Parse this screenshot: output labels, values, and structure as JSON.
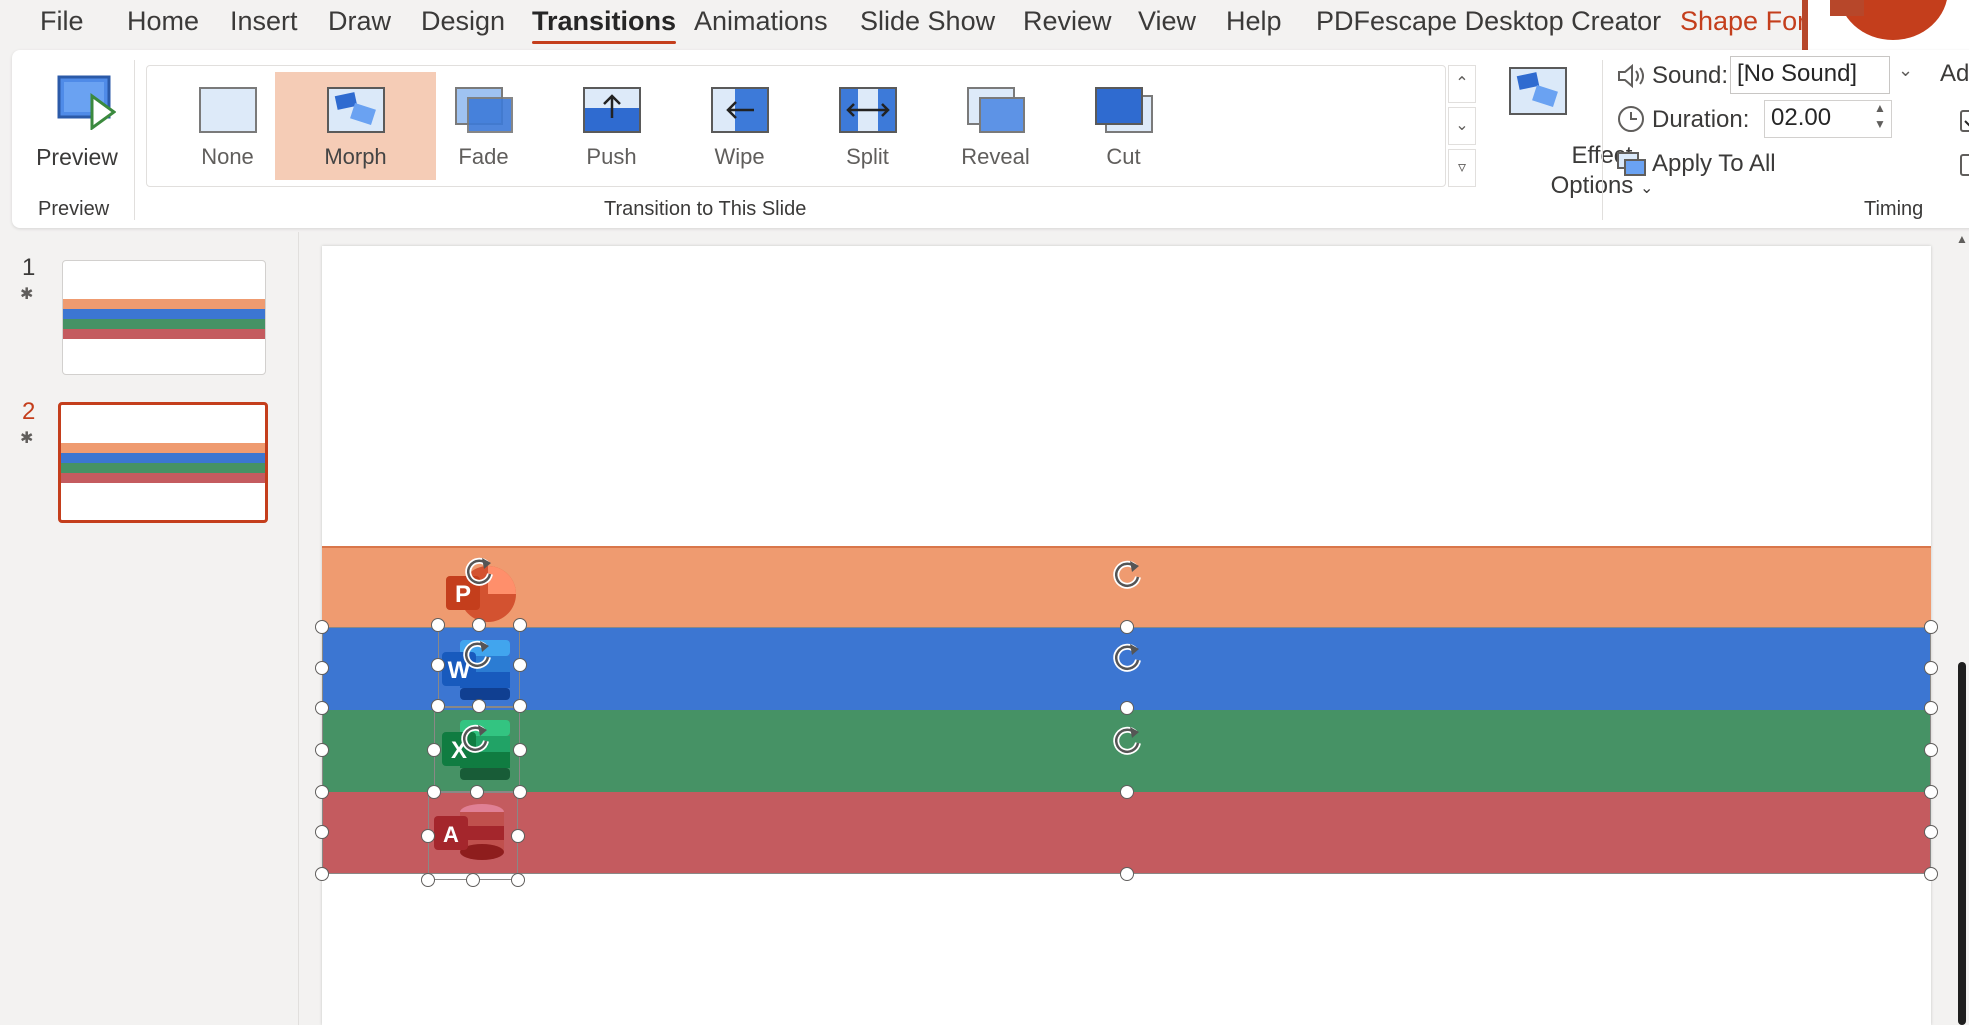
{
  "menu": {
    "items": [
      "File",
      "Home",
      "Insert",
      "Draw",
      "Design",
      "Transitions",
      "Animations",
      "Slide Show",
      "Review",
      "View",
      "Help",
      "PDFescape Desktop Creator",
      "Shape For"
    ],
    "active": "Transitions"
  },
  "ribbon": {
    "preview": {
      "button": "Preview",
      "group": "Preview"
    },
    "transitions": {
      "group": "Transition to This Slide",
      "items": [
        "None",
        "Morph",
        "Fade",
        "Push",
        "Wipe",
        "Split",
        "Reveal",
        "Cut"
      ],
      "selected": "Morph"
    },
    "effect_options": {
      "line1": "Effect",
      "line2": "Options"
    },
    "timing": {
      "group": "Timing",
      "sound_label": "Sound:",
      "sound_value": "[No Sound]",
      "duration_label": "Duration:",
      "duration_value": "02.00",
      "apply_all": "Apply To All",
      "advance_label": "Ad"
    }
  },
  "slides": {
    "numbers": [
      "1",
      "2"
    ],
    "active": "2"
  },
  "canvas": {
    "icon_letters": [
      "P",
      "W",
      "X",
      "A"
    ]
  },
  "colors": {
    "accent": "#c43e1c",
    "morph_highlight": "#f5ccb6",
    "band_orange": "#ef9b70",
    "band_blue": "#3c76d2",
    "band_green": "#469265",
    "band_red": "#c45b5f"
  }
}
